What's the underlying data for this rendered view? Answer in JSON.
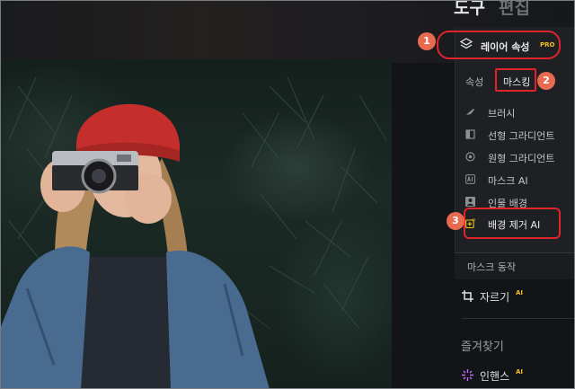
{
  "tabs": {
    "tools": "도구",
    "edit": "편집"
  },
  "layer_properties": {
    "label": "레이어 속성",
    "pro": "PRO"
  },
  "subtabs": {
    "properties": "속성",
    "masking": "마스킹"
  },
  "mask_menu": [
    {
      "label": "브러시",
      "icon": "brush-icon"
    },
    {
      "label": "선형 그라디언트",
      "icon": "linear-gradient-icon"
    },
    {
      "label": "원형 그라디언트",
      "icon": "radial-gradient-icon"
    },
    {
      "label": "마스크 AI",
      "icon": "mask-ai-icon"
    },
    {
      "label": "인물 배경",
      "icon": "person-background-icon"
    },
    {
      "label": "배경 제거 AI",
      "icon": "background-remove-icon"
    }
  ],
  "mask_actions": "마스크 동작",
  "crop": {
    "label": "자르기",
    "ai": "AI"
  },
  "favorites": "즐겨찾기",
  "enhance": {
    "label": "인핸스",
    "ai": "AI"
  },
  "badges": [
    "1",
    "2",
    "3"
  ],
  "colors": {
    "highlight": "#e0242e",
    "badge": "#e86a4f",
    "pro": "#f2c21b"
  }
}
